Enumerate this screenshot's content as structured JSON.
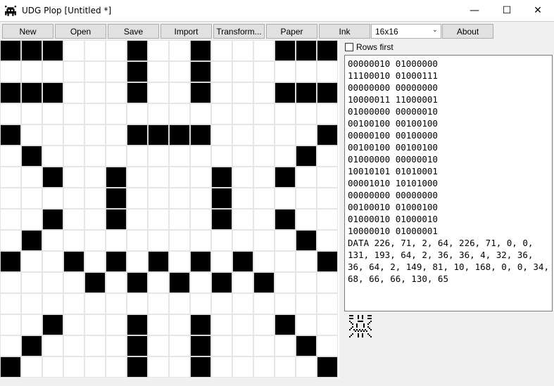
{
  "window": {
    "title": "UDG Plop [Untitled *]",
    "minimize": "—",
    "maximize": "☐",
    "close": "✕"
  },
  "toolbar": {
    "new": "New",
    "open": "Open",
    "save": "Save",
    "import": "Import",
    "transform": "Transform...",
    "paper": "Paper",
    "ink": "Ink",
    "size_value": "16x16",
    "about": "About"
  },
  "options": {
    "rows_first_label": "Rows first",
    "rows_first_checked": false
  },
  "output": {
    "binary_lines": [
      "00000010 01000000",
      "11100010 01000111",
      "00000000 00000000",
      "10000011 11000001",
      "01000000 00000010",
      "00100100 00100100",
      "00000100 00100000",
      "00100100 00100100",
      "01000000 00000010",
      "10010101 01010001",
      "00001010 10101000",
      "00000000 00000000",
      "00100010 01000100",
      "01000010 01000010",
      "10000010 01000001"
    ],
    "data_text": "DATA 226, 71, 2, 64, 226, 71, 0, 0, 131, 193, 64, 2, 36, 36, 4, 32, 36, 36, 64, 2, 149, 81, 10, 168, 0, 0, 34, 68, 66, 66, 130, 65"
  },
  "grid": {
    "rows": [
      "1110001001000111",
      "0000001001000000",
      "1110001001000111",
      "0000000000000000",
      "1000001111000001",
      "0100000000000010",
      "0010010000100100",
      "0000010000100000",
      "0010010000100100",
      "0100000000000010",
      "1001010101010001",
      "0000101010101000",
      "0000000000000000",
      "0010001001000100",
      "0100001001000010",
      "1000001001000001"
    ]
  },
  "colors": {
    "ink": "#000000",
    "paper": "#ffffff",
    "grid_line": "#e6e6e6"
  },
  "icons": {
    "app": "space-invader-icon"
  }
}
